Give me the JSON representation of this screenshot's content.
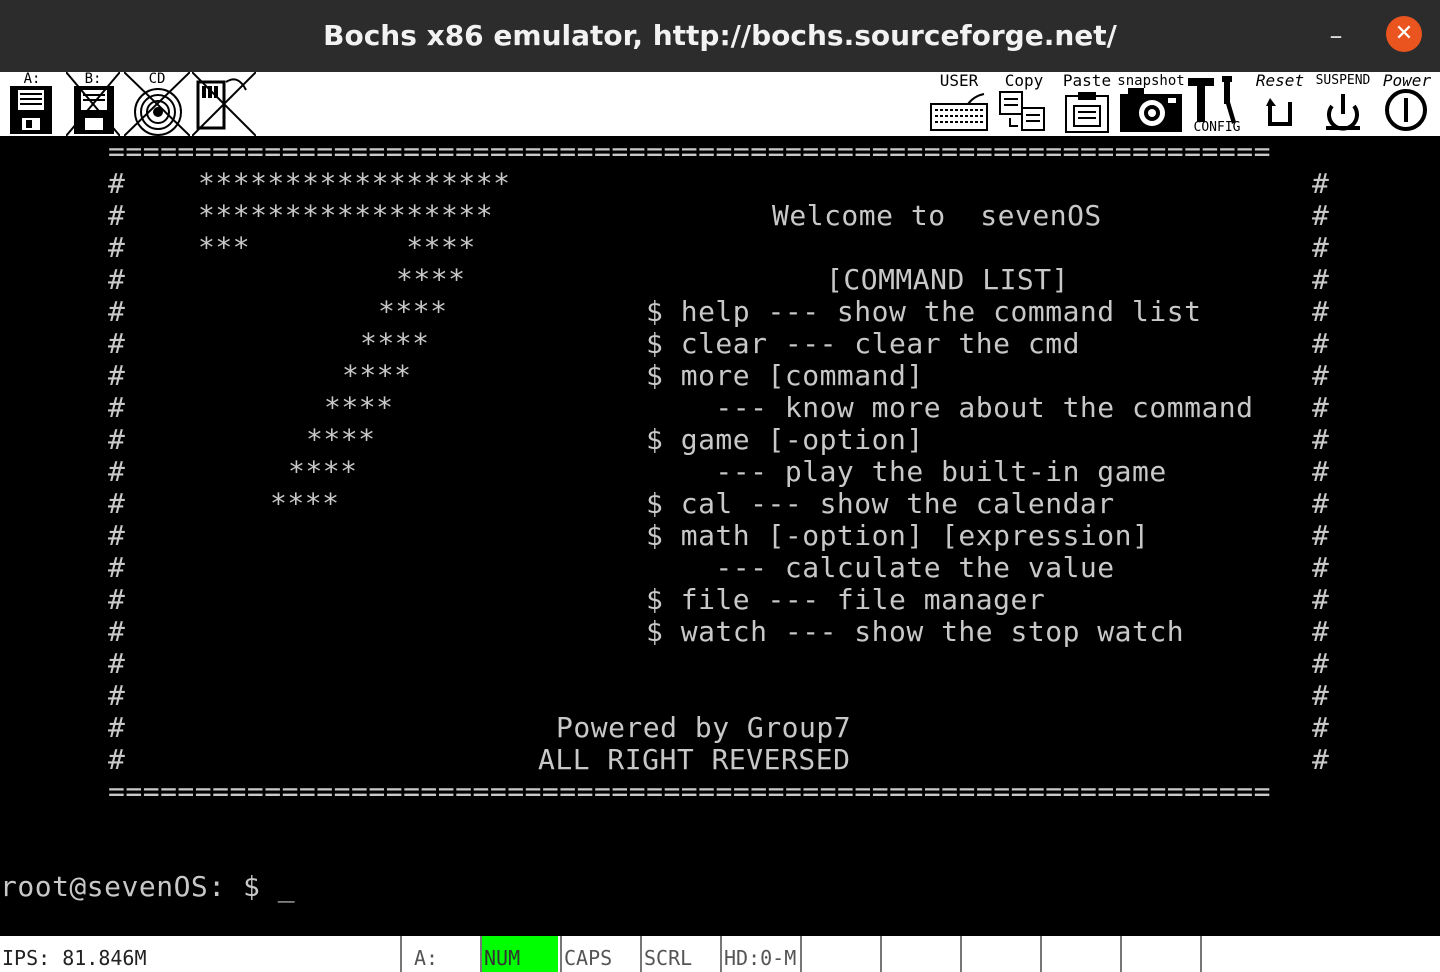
{
  "window": {
    "title": "Bochs x86 emulator, http://bochs.sourceforge.net/",
    "minimize_glyph": "–",
    "close_glyph": "✕",
    "close_color": "#e9541f"
  },
  "toolbar": {
    "floppy_a_label": "A:",
    "floppy_b_label": "B:",
    "cdrom_label": "CD",
    "user_label": "USER",
    "copy_label": "Copy",
    "paste_label": "Paste",
    "snapshot_label": "snapshot",
    "config_label": "CONFIG",
    "reset_label": "Reset",
    "suspend_label": "SUSPEND",
    "power_label": "Power",
    "icons": [
      "floppy-a-icon",
      "floppy-b-icon",
      "cdrom-icon",
      "usb-icon",
      "keyboard-icon",
      "copy-icon",
      "paste-icon",
      "camera-icon",
      "config-icon",
      "reset-icon",
      "suspend-icon",
      "power-icon"
    ]
  },
  "screen": {
    "border_top": "===================================================================",
    "border_bottom": "===================================================================",
    "left_border_char": "#",
    "right_border_char": "#",
    "logo": [
      "******************",
      "*****************",
      "***         ****",
      "****",
      "****",
      "****",
      "****",
      "****",
      "****",
      "****",
      "****"
    ],
    "welcome": "Welcome to  sevenOS",
    "command_list_header": "[COMMAND LIST]",
    "commands": [
      "$ help --- show the command list",
      "$ clear --- clear the cmd",
      "$ more [command]",
      "    --- know more about the command",
      "$ game [-option]",
      "    --- play the built-in game",
      "$ cal --- show the calendar",
      "$ math [-option] [expression]",
      "    --- calculate the value",
      "$ file --- file manager",
      "$ watch --- show the stop watch"
    ],
    "powered_by": "Powered by Group7",
    "rights": "ALL RIGHT REVERSED",
    "prompt": "root@sevenOS: $ _",
    "text_color": "#c8c8c8"
  },
  "statusbar": {
    "ips": "IPS: 81.846M",
    "floppy": "A:",
    "num": "NUM",
    "caps": "CAPS",
    "scrl": "SCRL",
    "hd": "HD:0-M",
    "num_active_color": "#00ff00"
  }
}
